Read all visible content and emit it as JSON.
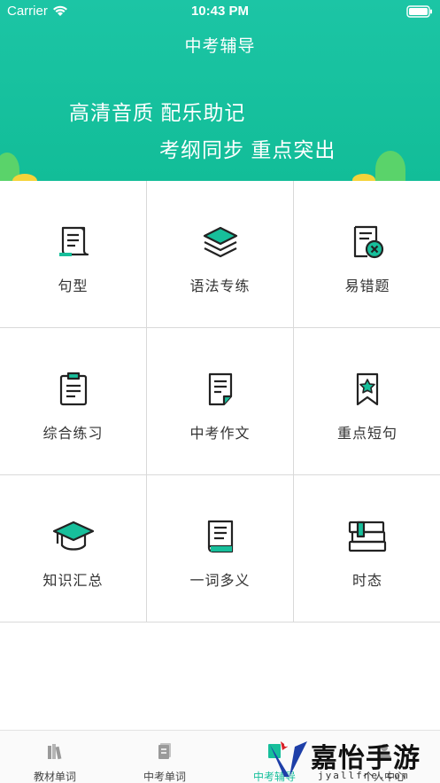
{
  "status_bar": {
    "carrier": "Carrier",
    "time": "10:43 PM"
  },
  "header": {
    "title": "中考辅导",
    "slogan_line1": "高清音质 配乐助记",
    "slogan_line2": "考纲同步 重点突出"
  },
  "colors": {
    "accent": "#17bf9b",
    "header_bg": "#1cc5a5",
    "icon_dark": "#222222"
  },
  "grid": {
    "items": [
      {
        "label": "句型",
        "icon": "scroll-icon"
      },
      {
        "label": "语法专练",
        "icon": "layers-icon"
      },
      {
        "label": "易错题",
        "icon": "error-doc-icon"
      },
      {
        "label": "综合练习",
        "icon": "clipboard-icon"
      },
      {
        "label": "中考作文",
        "icon": "essay-doc-icon"
      },
      {
        "label": "重点短句",
        "icon": "star-bookmark-icon"
      },
      {
        "label": "知识汇总",
        "icon": "graduation-cap-icon"
      },
      {
        "label": "一词多义",
        "icon": "book-icon"
      },
      {
        "label": "时态",
        "icon": "stacked-books-icon"
      }
    ]
  },
  "tabbar": {
    "tabs": [
      {
        "label": "教材单词",
        "icon": "books-icon"
      },
      {
        "label": "中考单词",
        "icon": "doc-icon"
      },
      {
        "label": "中考辅导",
        "icon": "guide-icon",
        "active": true
      },
      {
        "label": "个人中心",
        "icon": "person-icon"
      }
    ]
  },
  "watermark": {
    "title": "嘉怡手游网",
    "url": "jyallfne.com"
  }
}
